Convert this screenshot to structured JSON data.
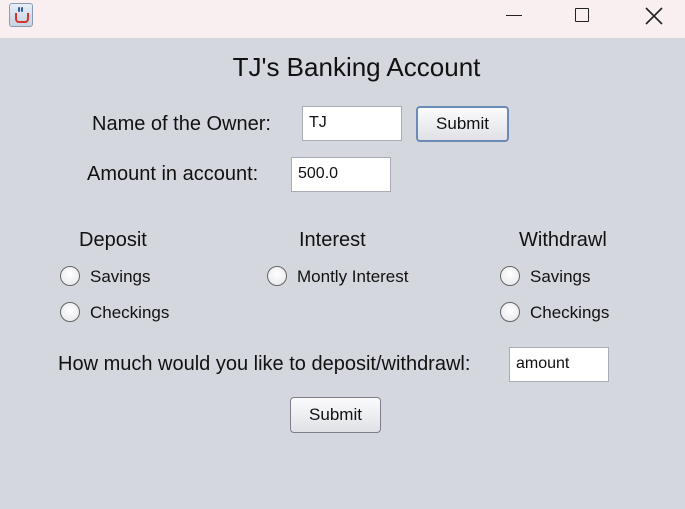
{
  "window": {
    "title": "",
    "controls": [
      "minimize-icon",
      "maximize-icon",
      "close-icon"
    ]
  },
  "app": {
    "title": "TJ's Banking Account",
    "owner": {
      "label": "Name of the Owner:",
      "value": "TJ",
      "submit_label": "Submit"
    },
    "amount": {
      "label": "Amount in account:",
      "value": "500.0"
    },
    "deposit": {
      "heading": "Deposit",
      "options": [
        "Savings",
        "Checkings"
      ]
    },
    "interest": {
      "heading": "Interest",
      "options": [
        "Montly Interest"
      ]
    },
    "withdraw": {
      "heading": "Withdrawl",
      "options": [
        "Savings",
        "Checkings"
      ]
    },
    "transaction": {
      "prompt": "How much would you like to deposit/withdrawl:",
      "amount_value": "amount",
      "submit_label": "Submit"
    }
  }
}
